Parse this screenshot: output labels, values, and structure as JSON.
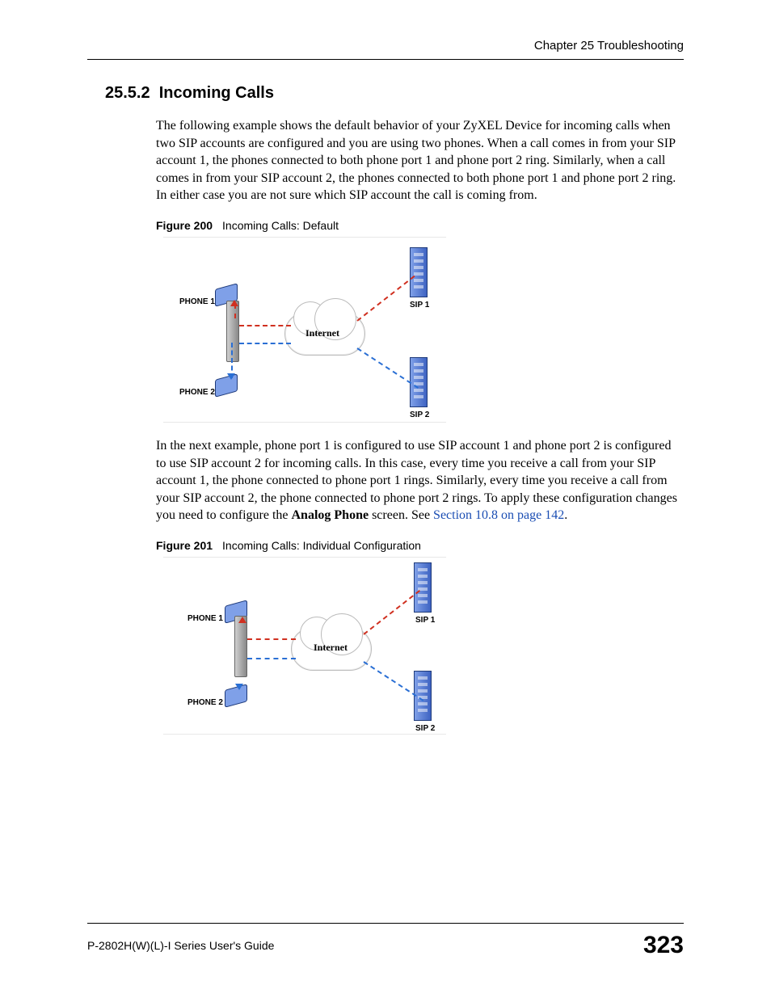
{
  "header": {
    "chapter": "Chapter 25 Troubleshooting"
  },
  "section": {
    "number": "25.5.2",
    "title": "Incoming Calls"
  },
  "para1": "The following example shows the default behavior of your ZyXEL Device for incoming calls when two SIP accounts are configured and you are using two phones. When a call comes in from your SIP account 1, the phones connected to both phone port 1 and phone port 2 ring. Similarly, when a call comes in from your SIP account 2, the phones connected to both phone port 1 and phone port 2 ring. In either case you are not sure which SIP account the call is coming from.",
  "figure1": {
    "label": "Figure 200",
    "caption": "Incoming Calls: Default",
    "labels": {
      "phone1": "PHONE 1",
      "phone2": "PHONE 2",
      "sip1": "SIP 1",
      "sip2": "SIP 2",
      "internet": "Internet"
    }
  },
  "para2_pre": "In the next example, phone port 1 is configured to use SIP account 1 and phone port 2 is configured to use SIP account 2 for incoming calls. In this case, every time you receive a call from your SIP account 1, the phone connected to phone port 1 rings. Similarly, every time you receive a call from your SIP account 2, the phone connected to phone port 2 rings. To apply these configuration changes you need to configure the ",
  "para2_bold": "Analog Phone",
  "para2_mid": " screen. See ",
  "para2_link": "Section 10.8 on page 142",
  "para2_post": ".",
  "figure2": {
    "label": "Figure 201",
    "caption": "Incoming Calls: Individual Configuration",
    "labels": {
      "phone1": "PHONE 1",
      "phone2": "PHONE 2",
      "sip1": "SIP 1",
      "sip2": "SIP 2",
      "internet": "Internet"
    }
  },
  "footer": {
    "guide": "P-2802H(W)(L)-I Series User's Guide",
    "page": "323"
  }
}
